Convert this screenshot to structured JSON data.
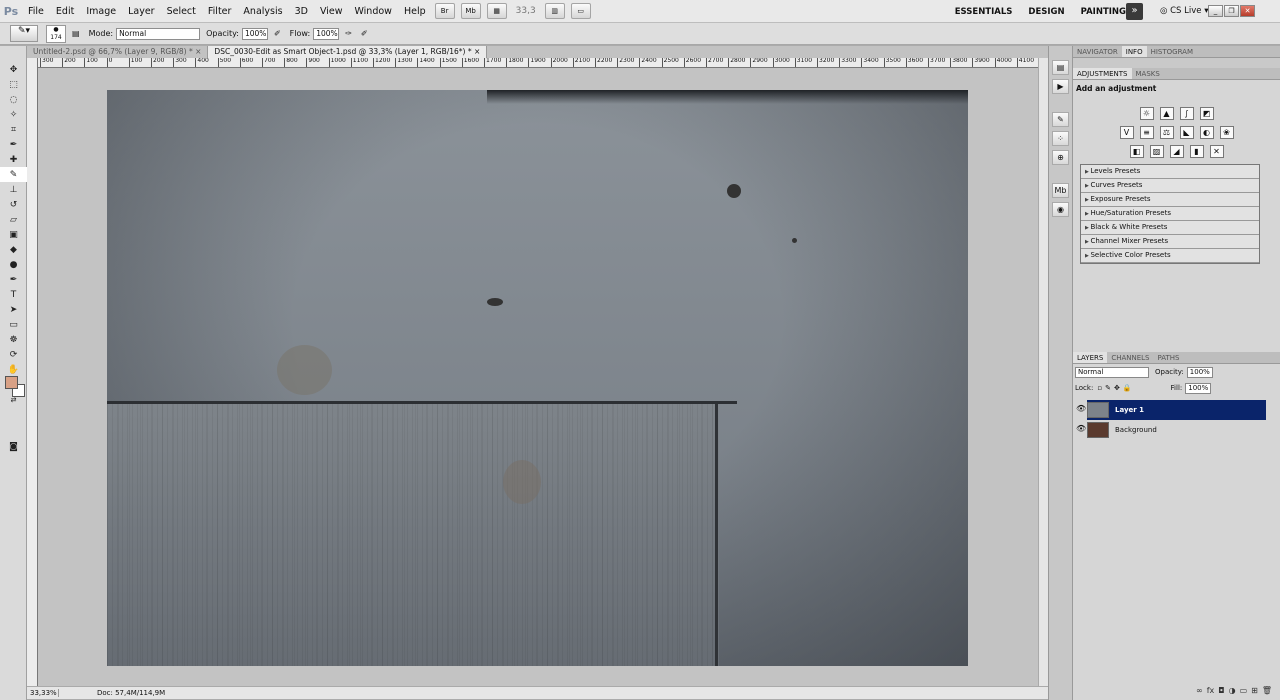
{
  "app": {
    "logo": "Ps"
  },
  "menu": [
    "File",
    "Edit",
    "Image",
    "Layer",
    "Select",
    "Filter",
    "Analysis",
    "3D",
    "View",
    "Window",
    "Help"
  ],
  "appbar": {
    "zoom": "33,3",
    "br_icon": "Br",
    "mb_icon": "Mb"
  },
  "workspaces": [
    "ESSENTIALS",
    "DESIGN",
    "PAINTING"
  ],
  "cs_live": "CS Live",
  "options": {
    "brush_size": "174",
    "mode_label": "Mode:",
    "mode_value": "Normal",
    "opacity_label": "Opacity:",
    "opacity_value": "100%",
    "flow_label": "Flow:",
    "flow_value": "100%"
  },
  "tabs": [
    "Untitled-2.psd @ 66,7% (Layer 9, RGB/8) *",
    "DSC_0030-Edit as Smart Object-1.psd @ 33,3% (Layer 1, RGB/16*) *"
  ],
  "ruler_labels": [
    "300",
    "200",
    "100",
    "0",
    "100",
    "200",
    "300",
    "400",
    "500",
    "600",
    "700",
    "800",
    "900",
    "1000",
    "1100",
    "1200",
    "1300",
    "1400",
    "1500",
    "1600",
    "1700",
    "1800",
    "1900",
    "2000",
    "2100",
    "2200",
    "2300",
    "2400",
    "2500",
    "2600",
    "2700",
    "2800",
    "2900",
    "3000",
    "3100",
    "3200",
    "3300",
    "3400",
    "3500",
    "3600",
    "3700",
    "3800",
    "3900",
    "4000",
    "4100"
  ],
  "status": {
    "zoom": "33,33%",
    "doc": "Doc: 57,4M/114,9M"
  },
  "colors": {
    "foreground": "#d8a186",
    "background": "#ffffff",
    "selected_layer": "#0a246a"
  },
  "panel": {
    "top_tabs": [
      "NAVIGATOR",
      "INFO",
      "HISTOGRAM"
    ],
    "adj_tabs": [
      "ADJUSTMENTS",
      "MASKS"
    ],
    "adj_title": "Add an adjustment",
    "presets": [
      "Levels Presets",
      "Curves Presets",
      "Exposure Presets",
      "Hue/Saturation Presets",
      "Black & White Presets",
      "Channel Mixer Presets",
      "Selective Color Presets"
    ],
    "layer_tabs": [
      "LAYERS",
      "CHANNELS",
      "PATHS"
    ],
    "blend_mode": "Normal",
    "opacity_label": "Opacity:",
    "opacity": "100%",
    "lock_label": "Lock:",
    "fill_label": "Fill:",
    "fill": "100%",
    "layers": [
      {
        "name": "Layer 1",
        "selected": true
      },
      {
        "name": "Background",
        "selected": false
      }
    ]
  }
}
